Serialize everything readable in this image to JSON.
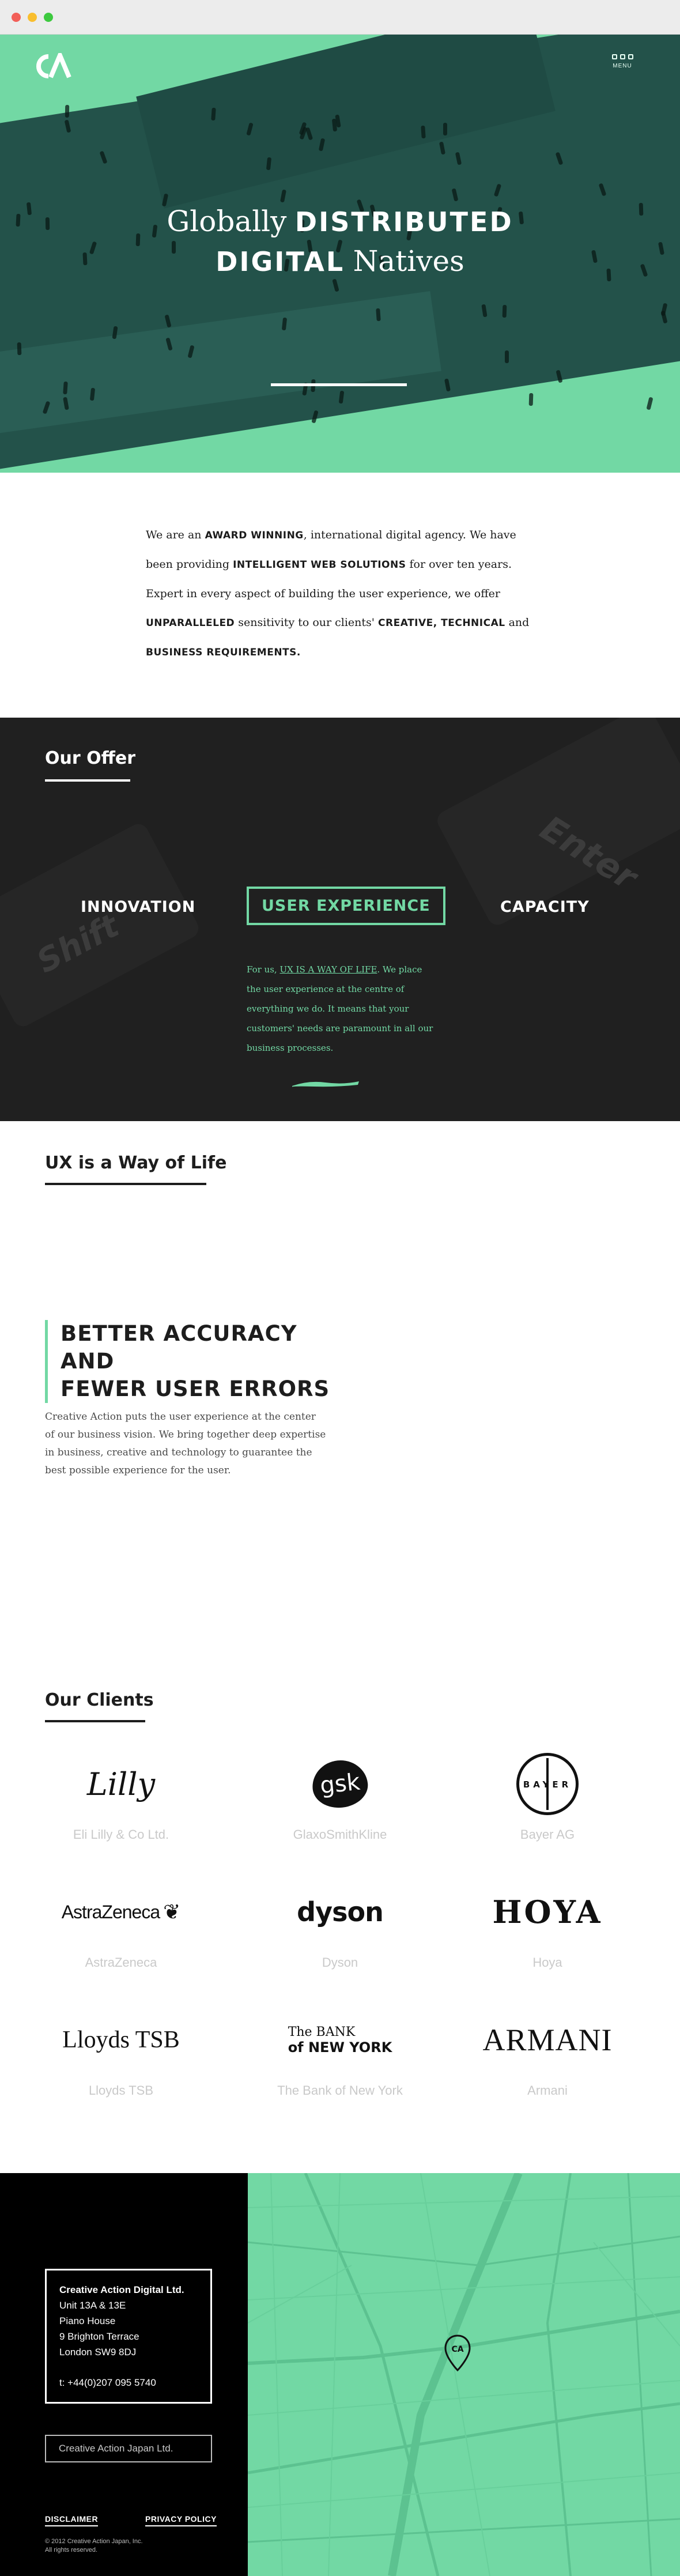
{
  "hero": {
    "title_part1": "Globally",
    "title_part2": "DISTRIBUTED",
    "title_part3": "DIGITAL",
    "title_part4": "Natives",
    "menu_label": "MENU"
  },
  "intro": {
    "t1": "We are an ",
    "b1": "AWARD WINNING",
    "t2": ", international digital agency. We have been providing ",
    "b2": "INTELLIGENT WEB SOLUTIONS",
    "t3": " for over ten years. Expert in every aspect of building the user experience, we offer ",
    "b3": "UNPARALLELED",
    "t4": " sensitivity to our clients' ",
    "b4": "CREATIVE, TECHNICAL",
    "t5": " and ",
    "b5": "BUSINESS REQUIREMENTS."
  },
  "offer": {
    "title": "Our Offer",
    "tabs": [
      "INNOVATION",
      "USER EXPERIENCE",
      "CAPACITY"
    ],
    "active_tab": "USER EXPERIENCE",
    "desc_part1": "For us, ",
    "desc_link": "UX IS A WAY OF LIFE",
    "desc_part2": ". We place the user experience at the centre of everything we do. It means that your customers' needs are paramount in all our business processes.",
    "key_label_left": "Shift",
    "key_label_right": "Enter"
  },
  "ux": {
    "title": "UX is a Way of Life",
    "heading_line1": "BETTER ACCURACY AND",
    "heading_line2": "FEWER USER ERRORS",
    "text": "Creative Action puts the user experience at the center of our business vision. We bring together deep expertise in business, creative and technology to guarantee the best possible experience for the user."
  },
  "clients": {
    "title": "Our Clients",
    "items": [
      {
        "logo_text": "Lilly",
        "name": "Eli Lilly & Co Ltd."
      },
      {
        "logo_text": "gsk",
        "name": "GlaxoSmithKline"
      },
      {
        "logo_text": "BAYER",
        "name": "Bayer AG"
      },
      {
        "logo_text": "AstraZeneca",
        "name": "AstraZeneca"
      },
      {
        "logo_text": "dyson",
        "name": "Dyson"
      },
      {
        "logo_text": "HOYA",
        "name": "Hoya"
      },
      {
        "logo_text": "Lloyds TSB",
        "name": "Lloyds TSB"
      },
      {
        "logo_text_line1": "The BANK",
        "logo_text_line2": "of NEW YORK",
        "name": "The Bank of New York"
      },
      {
        "logo_text": "ARMANI",
        "name": "Armani"
      }
    ]
  },
  "footer": {
    "company": "Creative Action Digital Ltd.",
    "address": [
      "Unit 13A & 13E",
      "Piano House",
      "9 Brighton Terrace",
      "London SW9 8DJ"
    ],
    "phone": "t: +44(0)207 095 5740",
    "japan_button": "Creative Action Japan Ltd.",
    "disclaimer": "DISCLAIMER",
    "privacy": "PRIVACY POLICY",
    "copyright_line1": "© 2012 Creative Action Japan, Inc.",
    "copyright_line2": "All rights reserved."
  },
  "colors": {
    "accent": "#72d8a4",
    "hero_dark": "#23524a",
    "offer_bg": "#202020",
    "footer_bg": "#000000"
  }
}
